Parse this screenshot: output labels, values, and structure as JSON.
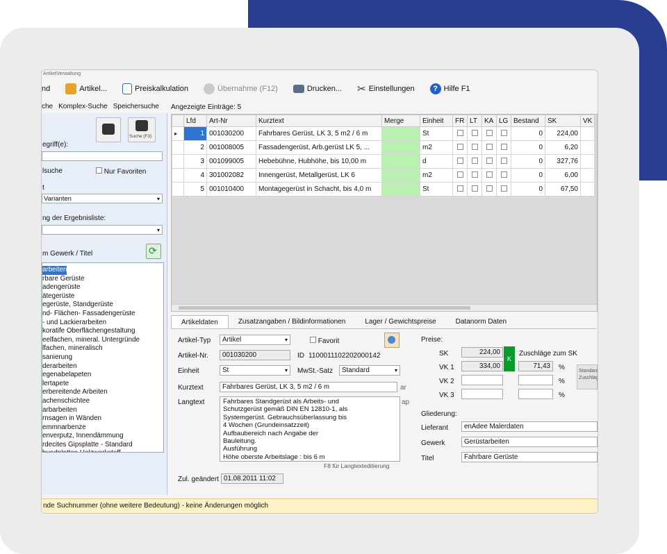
{
  "window": {
    "title": "ArtikelVerwaltung"
  },
  "toolbar": {
    "items": [
      {
        "label": "nd",
        "icon": "close-icon"
      },
      {
        "label": "Artikel...",
        "icon": "article-folder-icon"
      },
      {
        "label": "Preiskalkulation",
        "icon": "calculator-icon"
      },
      {
        "label": "Übernahme (F12)",
        "icon": "check-icon",
        "disabled": true
      },
      {
        "label": "Drucken...",
        "icon": "printer-icon"
      },
      {
        "label": "Einstellungen",
        "icon": "tools-icon"
      },
      {
        "label": "Hilfe F1",
        "icon": "help-icon"
      }
    ]
  },
  "search_tabs": [
    "che",
    "Komplex-Suche",
    "Speichersuche"
  ],
  "left": {
    "search_label": "egriff(e):",
    "search_value": "",
    "vollsuche": "lsuche",
    "nur_favoriten": "Nur Favoriten",
    "filter_label": "t",
    "filter_value": "Varianten",
    "sort_label": "ng der Ergebnisliste:",
    "sort_value": "",
    "tree_label": "m Gewerk / Titel",
    "find_button": "Suche (F3)",
    "tree_items": [
      "arbeiten",
      "rbare Gerüste",
      "adengerüste",
      "ätegerüste",
      "egerüste, Standgerüste",
      "nd- Flächen- Fassadengerüste",
      "- und Lackierarbeiten",
      "koratife Oberflächengestaltung",
      "eelfachen, mineral. Untergründe",
      "lfachen, mineralisch",
      "sanierung",
      "derarbeiten",
      "egenabelapeten",
      "lertapete",
      "erbereitende Arbeiten",
      "achenschichtee",
      "arbarbeiten",
      "rnsagen in Wänden",
      "emmnarbenze",
      "enverputz, Innendämmung",
      "rdecites Gipsplatte - Standard",
      "bundplatten Holzwerkstoff"
    ]
  },
  "grid": {
    "caption": "Angezeigte Einträge: 5",
    "columns": [
      "Lfd",
      "Art-Nr",
      "Kurztext",
      "Merge",
      "Einheit",
      "FR",
      "LT",
      "KA",
      "LG",
      "Bestand",
      "SK",
      "VK"
    ],
    "rows": [
      {
        "lfd": "1",
        "art": "001030200",
        "kurz": "Fahrbares Gerüst, LK 3, 5 m2 / 6 m",
        "einheit": "St",
        "bestand": "0",
        "sk": "224,00"
      },
      {
        "lfd": "2",
        "art": "001008005",
        "kurz": "Fassadengerüst, Arb.gerüst LK 5, ...",
        "einheit": "m2",
        "bestand": "0",
        "sk": "6,20"
      },
      {
        "lfd": "3",
        "art": "001099005",
        "kurz": "Hebebühne, Hubhöhe, bis 10,00 m",
        "einheit": "d",
        "bestand": "0",
        "sk": "327,76"
      },
      {
        "lfd": "4",
        "art": "301002082",
        "kurz": "Innengerüst, Metallgerüst, LK 6",
        "einheit": "m2",
        "bestand": "0",
        "sk": "6,00"
      },
      {
        "lfd": "5",
        "art": "001010400",
        "kurz": "Montagegerüst in Schacht, bis 4,0 m",
        "einheit": "St",
        "bestand": "0",
        "sk": "67,50"
      }
    ]
  },
  "detail_tabs": [
    "Artikeldaten",
    "Zusatzangaben / Bildinformationen",
    "Lager / Gewichtspreise",
    "Datanorm Daten"
  ],
  "detail": {
    "artikeltyp_label": "Artikel-Typ",
    "artikeltyp_value": "Artikel",
    "favorit_label": "Favorit",
    "artnr_label": "Artikel-Nr.",
    "artnr_value": "001030200",
    "id_label": "ID",
    "id_value": "1100011102202000142",
    "einheit_label": "Einheit",
    "einheit_value": "St",
    "mwst_label": "MwSt.-Satz",
    "mwst_value": "Standard",
    "kurztext_label": "Kurztext",
    "kurztext_value": "Fahrbares Gerüst, LK 3, 5 m2 / 6 m",
    "kurztext_suffix": "ar",
    "langtext_label": "Langtext",
    "langtext_suffix": "ap",
    "langtext_lines": [
      "Fahrbares Standgerüst als Arbeits- und",
      "Schutzgerüst gemäß DIN EN 12810-1, als",
      "Systemgerüst. Gebrauchsüberlassung bis",
      "4 Wochen (Grundeinsatzzeit)",
      "Aufbaubereich nach Angabe der",
      "Bauleitung.",
      "Ausführung",
      "Höhe oberste Arbeitslage : bis 6 m"
    ],
    "langtext_hint": "F8 für Langtexteditierung",
    "geaendert_label": "Zul. geändert",
    "geaendert_value": "01.08.2011 11:02"
  },
  "prices": {
    "title": "Preise:",
    "sk_label": "SK",
    "sk_value": "224,00",
    "k_button": "K",
    "zuschlag_label": "Zuschläge zum SK",
    "vk1_label": "VK 1",
    "vk1_value": "334,00",
    "vk1_pct": "71,43",
    "pct_sign": "%",
    "vk2_label": "VK 2",
    "vk3_label": "VK 3",
    "side_button": "Standard Zuschläge"
  },
  "gliederung": {
    "title": "Gliederung:",
    "lieferant_label": "Lieferant",
    "lieferant_value": "enAdee Malerdaten",
    "gewerk_label": "Gewerk",
    "gewerk_value": "Gerüstarbeiten",
    "titel_label": "Titel",
    "titel_value": "Fahrbare Gerüste"
  },
  "status": {
    "text": "nde Suchnummer (ohne weitere Bedeutung) - keine Änderungen möglich"
  }
}
